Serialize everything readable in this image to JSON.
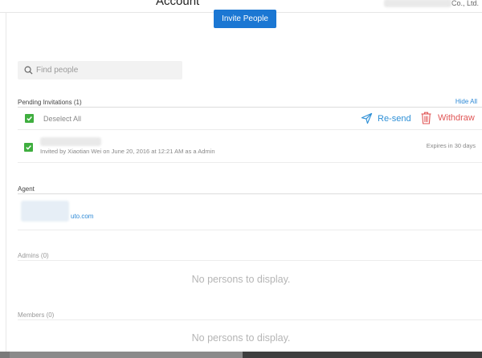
{
  "header": {
    "title": "Account",
    "company_suffix": "Co., Ltd."
  },
  "invite_button": "Invite People",
  "search": {
    "placeholder": "Find people"
  },
  "pending": {
    "heading": "Pending Invitations (1)",
    "hide_all": "Hide All",
    "deselect_all": "Deselect All",
    "resend": "Re-send",
    "withdraw": "Withdraw",
    "invitations": [
      {
        "detail": "Invited by Xiaotian Wei on June 20, 2016 at 12:21 AM as a Admin",
        "expires": "Expires in 30 days",
        "checked": true
      }
    ]
  },
  "agent": {
    "heading": "Agent",
    "email_suffix": "uto.com"
  },
  "admins": {
    "heading": "Admins (0)",
    "empty": "No persons to display."
  },
  "members": {
    "heading": "Members (0)",
    "empty": "No persons to display."
  },
  "colors": {
    "primary": "#1b77d3",
    "link": "#2d89d6",
    "check": "#3fae3f",
    "danger": "#e05555"
  }
}
